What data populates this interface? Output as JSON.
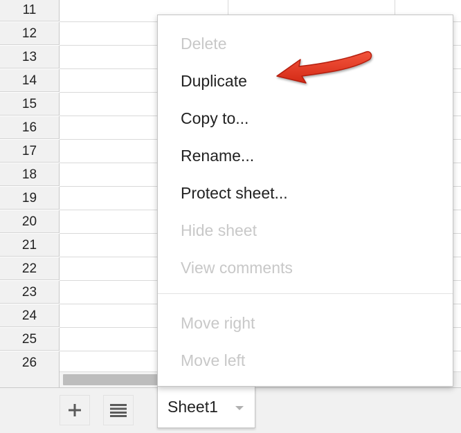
{
  "grid": {
    "row_numbers": [
      "11",
      "12",
      "13",
      "14",
      "15",
      "16",
      "17",
      "18",
      "19",
      "20",
      "21",
      "22",
      "23",
      "24",
      "25",
      "26"
    ]
  },
  "sheet_bar": {
    "add_sheet_icon": "plus-icon",
    "all_sheets_icon": "list-icon",
    "active_tab": {
      "label": "Sheet1",
      "dropdown_icon": "caret-down-icon"
    }
  },
  "context_menu": {
    "items": [
      {
        "label": "Delete",
        "enabled": false
      },
      {
        "label": "Duplicate",
        "enabled": true
      },
      {
        "label": "Copy to...",
        "enabled": true
      },
      {
        "label": "Rename...",
        "enabled": true
      },
      {
        "label": "Protect sheet...",
        "enabled": true
      },
      {
        "label": "Hide sheet",
        "enabled": false
      },
      {
        "label": "View comments",
        "enabled": false
      },
      {
        "label": "Move right",
        "enabled": false
      },
      {
        "label": "Move left",
        "enabled": false
      }
    ]
  },
  "annotation": {
    "arrow_color": "#e8301c",
    "points_to": "Duplicate"
  },
  "colors": {
    "menu_text": "#222222",
    "disabled_text": "#c8c8c8",
    "row_header_bg": "#f1f1f1",
    "gridline": "#d9d9d9"
  }
}
